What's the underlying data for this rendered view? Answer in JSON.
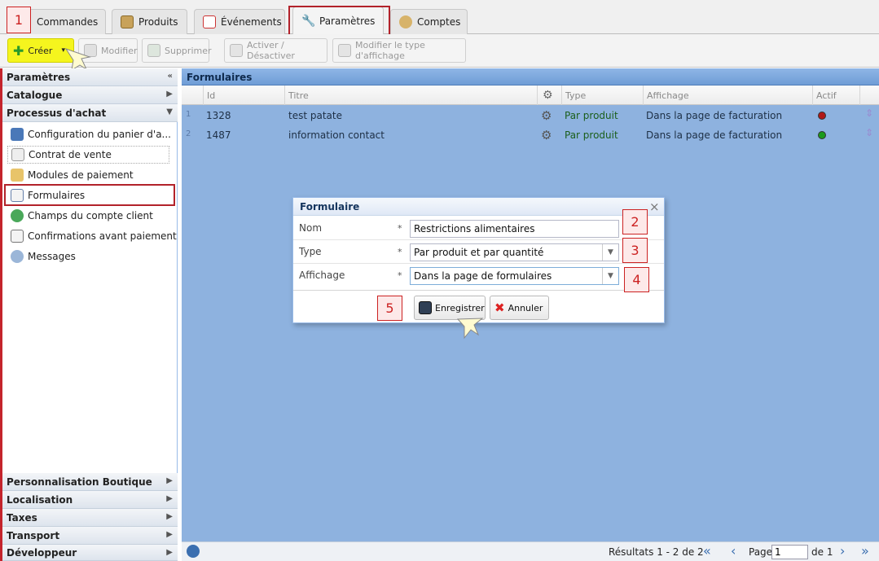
{
  "tabs": [
    {
      "label": "Commandes"
    },
    {
      "label": "Produits"
    },
    {
      "label": "Événements"
    },
    {
      "label": "Paramètres"
    },
    {
      "label": "Comptes"
    }
  ],
  "toolbar": {
    "create": "Créer",
    "modify": "Modifier",
    "delete": "Supprimer",
    "activate": "Activer / Désactiver",
    "display_type": "Modifier le type d'affichage"
  },
  "sidebar": {
    "sections_top": [
      "Paramètres",
      "Catalogue",
      "Processus d'achat"
    ],
    "items": [
      "Configuration du panier d'a...",
      "Contrat de vente",
      "Modules de paiement",
      "Formulaires",
      "Champs du compte client",
      "Confirmations avant paiement",
      "Messages"
    ],
    "sections_bottom": [
      "Personnalisation Boutique",
      "Localisation",
      "Taxes",
      "Transport",
      "Développeur"
    ]
  },
  "grid": {
    "title": "Formulaires",
    "columns": [
      "Id",
      "Titre",
      "Type",
      "Affichage",
      "Actif"
    ],
    "rows": [
      {
        "num": "1",
        "id": "1328",
        "title": "test patate",
        "type": "Par produit",
        "display": "Dans la page de facturation",
        "active_color": "#b01818"
      },
      {
        "num": "2",
        "id": "1487",
        "title": "information contact",
        "type": "Par produit",
        "display": "Dans la page de facturation",
        "active_color": "#1c9a1c"
      }
    ]
  },
  "dialog": {
    "title": "Formulaire",
    "fields": [
      {
        "label": "Nom",
        "required": "*",
        "value": "Restrictions alimentaires"
      },
      {
        "label": "Type",
        "required": "*",
        "value": "Par produit et par quantité"
      },
      {
        "label": "Affichage",
        "required": "*",
        "value": "Dans la page de formulaires"
      }
    ],
    "save": "Enregistrer",
    "cancel": "Annuler",
    "close": "×"
  },
  "callouts": [
    "1",
    "2",
    "3",
    "4",
    "5"
  ],
  "pager": {
    "results": "Résultats 1 - 2 de 2",
    "page_label": "Page",
    "page_value": "1",
    "of": "de 1"
  },
  "colors": {
    "grid_bg": "#8eb2df",
    "header": "#6f9dd6",
    "callout_border": "#c22",
    "highlight": "#b2222a",
    "create_btn": "#f5f51e"
  }
}
